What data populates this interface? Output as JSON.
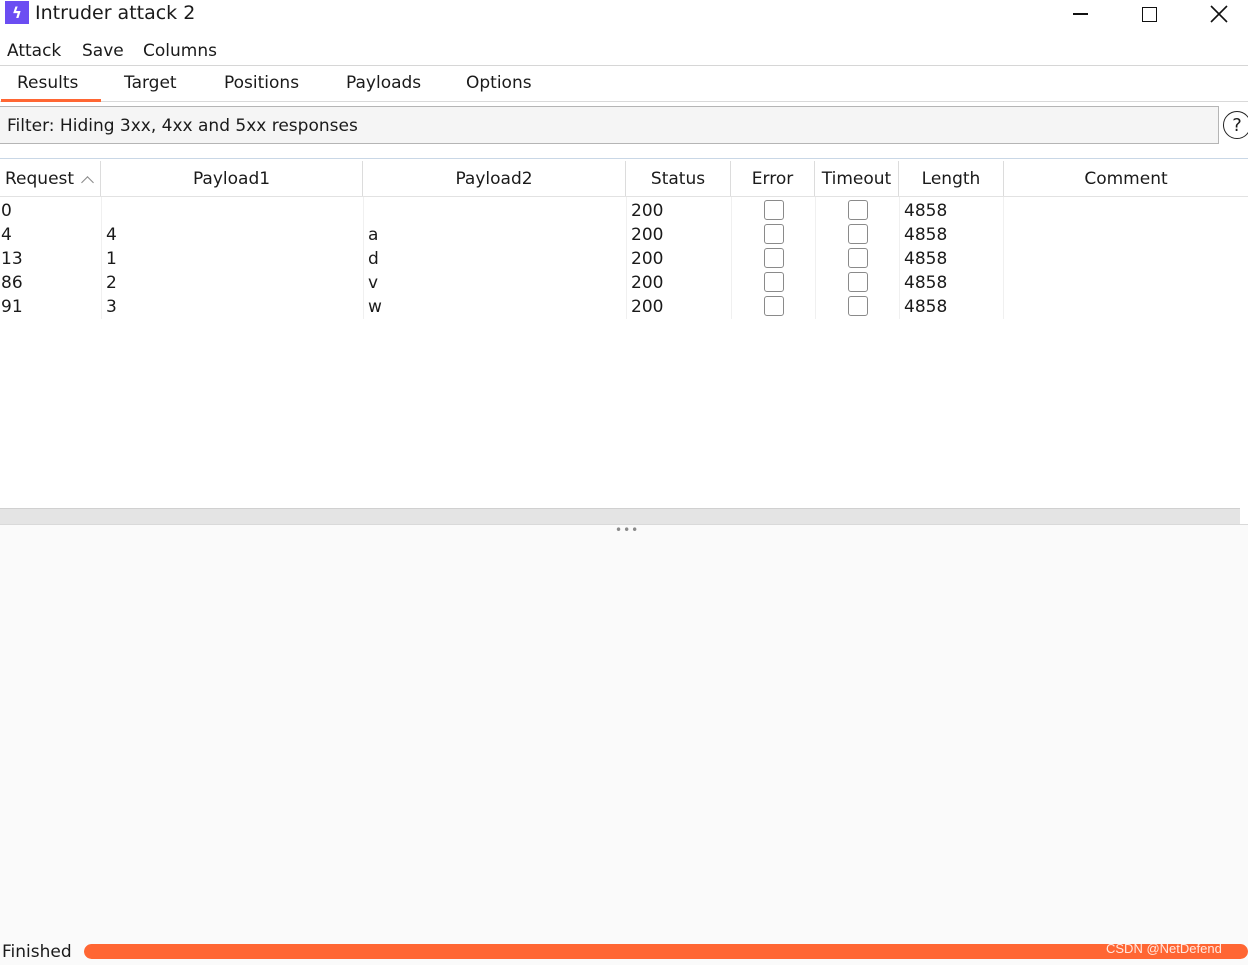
{
  "window": {
    "title": "Intruder attack 2",
    "icon": "lightning-icon"
  },
  "menubar": {
    "items": [
      "Attack",
      "Save",
      "Columns"
    ]
  },
  "tabs": {
    "items": [
      "Results",
      "Target",
      "Positions",
      "Payloads",
      "Options"
    ],
    "active": "Results"
  },
  "filter": {
    "text": "Filter: Hiding 3xx, 4xx and 5xx responses",
    "help_icon": "question-icon"
  },
  "table": {
    "headers": [
      "Request",
      "Payload1",
      "Payload2",
      "Status",
      "Error",
      "Timeout",
      "Length",
      "Comment"
    ],
    "sorted_column": "Request",
    "rows": [
      {
        "request": "0",
        "payload1": "",
        "payload2": "",
        "status": "200",
        "error": false,
        "timeout": false,
        "length": "4858",
        "comment": ""
      },
      {
        "request": "4",
        "payload1": "4",
        "payload2": "a",
        "status": "200",
        "error": false,
        "timeout": false,
        "length": "4858",
        "comment": ""
      },
      {
        "request": "13",
        "payload1": "1",
        "payload2": "d",
        "status": "200",
        "error": false,
        "timeout": false,
        "length": "4858",
        "comment": ""
      },
      {
        "request": "86",
        "payload1": "2",
        "payload2": "v",
        "status": "200",
        "error": false,
        "timeout": false,
        "length": "4858",
        "comment": ""
      },
      {
        "request": "91",
        "payload1": "3",
        "payload2": "w",
        "status": "200",
        "error": false,
        "timeout": false,
        "length": "4858",
        "comment": ""
      }
    ]
  },
  "status": {
    "text": "Finished",
    "progress": 1.0
  },
  "colors": {
    "accent": "#ff6633",
    "icon_purple": "#6b4df2"
  },
  "watermark": "CSDN @NetDefend"
}
